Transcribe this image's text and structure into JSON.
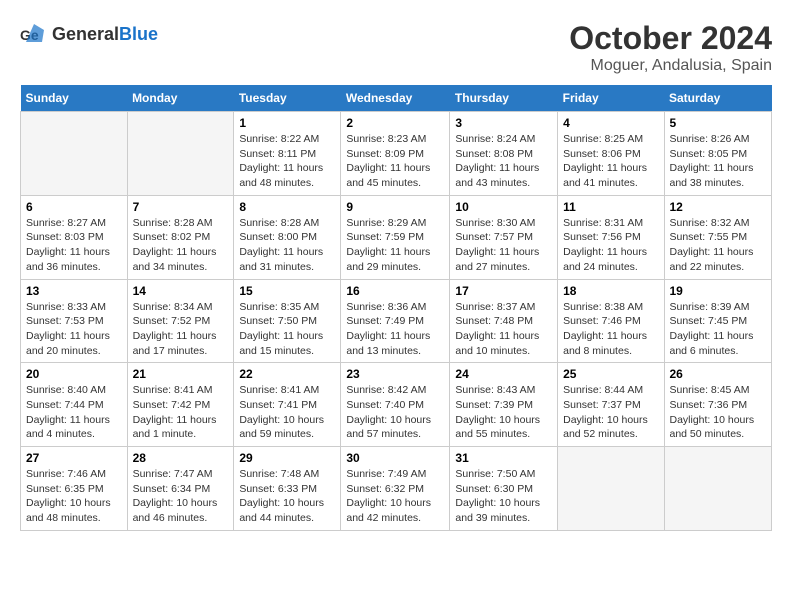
{
  "logo": {
    "general": "General",
    "blue": "Blue"
  },
  "title": "October 2024",
  "location": "Moguer, Andalusia, Spain",
  "days_of_week": [
    "Sunday",
    "Monday",
    "Tuesday",
    "Wednesday",
    "Thursday",
    "Friday",
    "Saturday"
  ],
  "weeks": [
    [
      {
        "day": null
      },
      {
        "day": null
      },
      {
        "day": 1,
        "sunrise": "8:22 AM",
        "sunset": "8:11 PM",
        "daylight": "11 hours and 48 minutes."
      },
      {
        "day": 2,
        "sunrise": "8:23 AM",
        "sunset": "8:09 PM",
        "daylight": "11 hours and 45 minutes."
      },
      {
        "day": 3,
        "sunrise": "8:24 AM",
        "sunset": "8:08 PM",
        "daylight": "11 hours and 43 minutes."
      },
      {
        "day": 4,
        "sunrise": "8:25 AM",
        "sunset": "8:06 PM",
        "daylight": "11 hours and 41 minutes."
      },
      {
        "day": 5,
        "sunrise": "8:26 AM",
        "sunset": "8:05 PM",
        "daylight": "11 hours and 38 minutes."
      }
    ],
    [
      {
        "day": 6,
        "sunrise": "8:27 AM",
        "sunset": "8:03 PM",
        "daylight": "11 hours and 36 minutes."
      },
      {
        "day": 7,
        "sunrise": "8:28 AM",
        "sunset": "8:02 PM",
        "daylight": "11 hours and 34 minutes."
      },
      {
        "day": 8,
        "sunrise": "8:28 AM",
        "sunset": "8:00 PM",
        "daylight": "11 hours and 31 minutes."
      },
      {
        "day": 9,
        "sunrise": "8:29 AM",
        "sunset": "7:59 PM",
        "daylight": "11 hours and 29 minutes."
      },
      {
        "day": 10,
        "sunrise": "8:30 AM",
        "sunset": "7:57 PM",
        "daylight": "11 hours and 27 minutes."
      },
      {
        "day": 11,
        "sunrise": "8:31 AM",
        "sunset": "7:56 PM",
        "daylight": "11 hours and 24 minutes."
      },
      {
        "day": 12,
        "sunrise": "8:32 AM",
        "sunset": "7:55 PM",
        "daylight": "11 hours and 22 minutes."
      }
    ],
    [
      {
        "day": 13,
        "sunrise": "8:33 AM",
        "sunset": "7:53 PM",
        "daylight": "11 hours and 20 minutes."
      },
      {
        "day": 14,
        "sunrise": "8:34 AM",
        "sunset": "7:52 PM",
        "daylight": "11 hours and 17 minutes."
      },
      {
        "day": 15,
        "sunrise": "8:35 AM",
        "sunset": "7:50 PM",
        "daylight": "11 hours and 15 minutes."
      },
      {
        "day": 16,
        "sunrise": "8:36 AM",
        "sunset": "7:49 PM",
        "daylight": "11 hours and 13 minutes."
      },
      {
        "day": 17,
        "sunrise": "8:37 AM",
        "sunset": "7:48 PM",
        "daylight": "11 hours and 10 minutes."
      },
      {
        "day": 18,
        "sunrise": "8:38 AM",
        "sunset": "7:46 PM",
        "daylight": "11 hours and 8 minutes."
      },
      {
        "day": 19,
        "sunrise": "8:39 AM",
        "sunset": "7:45 PM",
        "daylight": "11 hours and 6 minutes."
      }
    ],
    [
      {
        "day": 20,
        "sunrise": "8:40 AM",
        "sunset": "7:44 PM",
        "daylight": "11 hours and 4 minutes."
      },
      {
        "day": 21,
        "sunrise": "8:41 AM",
        "sunset": "7:42 PM",
        "daylight": "11 hours and 1 minute."
      },
      {
        "day": 22,
        "sunrise": "8:41 AM",
        "sunset": "7:41 PM",
        "daylight": "10 hours and 59 minutes."
      },
      {
        "day": 23,
        "sunrise": "8:42 AM",
        "sunset": "7:40 PM",
        "daylight": "10 hours and 57 minutes."
      },
      {
        "day": 24,
        "sunrise": "8:43 AM",
        "sunset": "7:39 PM",
        "daylight": "10 hours and 55 minutes."
      },
      {
        "day": 25,
        "sunrise": "8:44 AM",
        "sunset": "7:37 PM",
        "daylight": "10 hours and 52 minutes."
      },
      {
        "day": 26,
        "sunrise": "8:45 AM",
        "sunset": "7:36 PM",
        "daylight": "10 hours and 50 minutes."
      }
    ],
    [
      {
        "day": 27,
        "sunrise": "7:46 AM",
        "sunset": "6:35 PM",
        "daylight": "10 hours and 48 minutes."
      },
      {
        "day": 28,
        "sunrise": "7:47 AM",
        "sunset": "6:34 PM",
        "daylight": "10 hours and 46 minutes."
      },
      {
        "day": 29,
        "sunrise": "7:48 AM",
        "sunset": "6:33 PM",
        "daylight": "10 hours and 44 minutes."
      },
      {
        "day": 30,
        "sunrise": "7:49 AM",
        "sunset": "6:32 PM",
        "daylight": "10 hours and 42 minutes."
      },
      {
        "day": 31,
        "sunrise": "7:50 AM",
        "sunset": "6:30 PM",
        "daylight": "10 hours and 39 minutes."
      },
      {
        "day": null
      },
      {
        "day": null
      }
    ]
  ]
}
